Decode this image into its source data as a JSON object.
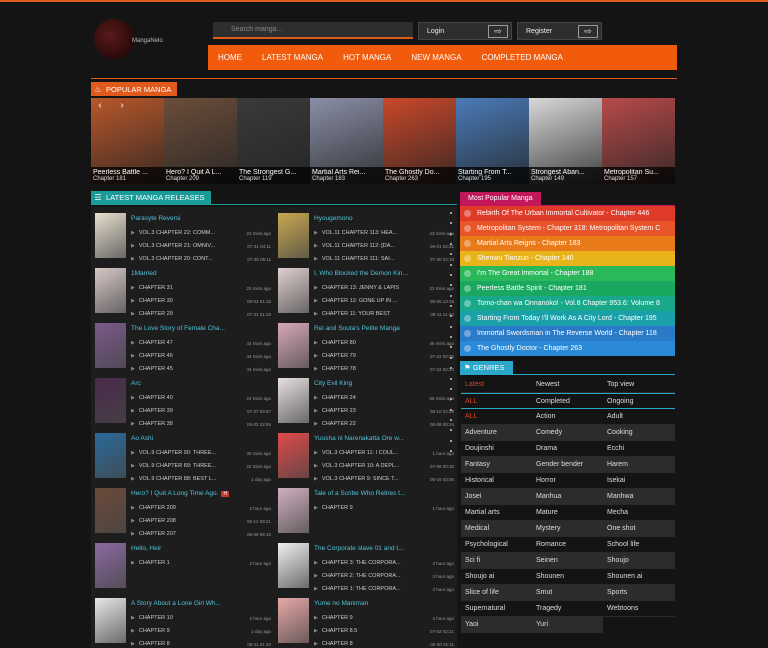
{
  "header": {
    "logo_text": "MangaNelo",
    "search_placeholder": "Search manga...",
    "login_label": "Login",
    "register_label": "Register"
  },
  "nav": [
    "HOME",
    "LATEST MANGA",
    "HOT MANGA",
    "NEW MANGA",
    "COMPLETED MANGA"
  ],
  "popular": {
    "title": "POPULAR MANGA",
    "items": [
      {
        "title": "Peerless Battle ...",
        "chapter": "Chapter 181",
        "color": "#b8572a"
      },
      {
        "title": "Hero? I Quit A L...",
        "chapter": "Chapter 209",
        "color": "#6b4d3a"
      },
      {
        "title": "The Strongest G...",
        "chapter": "Chapter 119",
        "color": "#3a3a3a"
      },
      {
        "title": "Martial Arts Rei...",
        "chapter": "Chapter 183",
        "color": "#8a8fa6"
      },
      {
        "title": "The Ghostly Do...",
        "chapter": "Chapter 263",
        "color": "#c9482a"
      },
      {
        "title": "Starting From T...",
        "chapter": "Chapter 195",
        "color": "#4a7bb8"
      },
      {
        "title": "Strongest Aban...",
        "chapter": "Chapter 149",
        "color": "#d8d8d8"
      },
      {
        "title": "Metropolitan Su...",
        "chapter": "Chapter 157",
        "color": "#b84a4a"
      }
    ]
  },
  "latest": {
    "title": "LATEST MANGA RELEASES",
    "left": [
      {
        "title": "Parasyte Reversi",
        "color": "#e8e0d0",
        "hot": false,
        "chapters": [
          [
            "VOL.3 CHAPTER 22: COMM...",
            "23 mins ago"
          ],
          [
            "VOL.3 CHAPTER 21: OMNIV...",
            "07-31 04:11"
          ],
          [
            "VOL.3 CHAPTER 20: CONT...",
            "07-30 05:11"
          ]
        ]
      },
      {
        "title": "1Married",
        "color": "#d8c8c8",
        "hot": false,
        "chapters": [
          [
            "CHAPTER 31",
            "23 mins ago"
          ],
          [
            "CHAPTER 30",
            "08-03 01:16"
          ],
          [
            "CHAPTER 29",
            "07-31 21:16"
          ]
        ]
      },
      {
        "title": "The Love Story of Female Cha...",
        "color": "#7a5a8a",
        "hot": false,
        "chapters": [
          [
            "CHAPTER 47",
            "44 mins ago"
          ],
          [
            "CHAPTER 46",
            "44 mins ago"
          ],
          [
            "CHAPTER 45",
            "44 mins ago"
          ]
        ]
      },
      {
        "title": "Arc",
        "color": "#4a2a4a",
        "hot": false,
        "chapters": [
          [
            "CHAPTER 40",
            "24 mins ago"
          ],
          [
            "CHAPTER 39",
            "07-27 03:57"
          ],
          [
            "CHAPTER 38",
            "05-02 22:55"
          ]
        ]
      },
      {
        "title": "Ao Ashi",
        "color": "#2a6a9a",
        "hot": false,
        "chapters": [
          [
            "VOL.9 CHAPTER 90: THREE...",
            "30 mins ago"
          ],
          [
            "VOL.9 CHAPTER 89: THREE...",
            "22 mins ago"
          ],
          [
            "VOL.9 CHAPTER 88: BEST L...",
            "1 day ago"
          ]
        ]
      },
      {
        "title": "Hero? I Quit A Long Time Ago.",
        "color": "#6a4a3a",
        "hot": true,
        "chapters": [
          [
            "CHAPTER 209",
            "2 hour ago"
          ],
          [
            "CHAPTER 208",
            "06-12 08:21"
          ],
          [
            "CHAPTER 207",
            "06-09 06:15"
          ]
        ]
      },
      {
        "title": "Hello, Heir",
        "color": "#8a6aa0",
        "hot": false,
        "chapters": [
          [
            "CHAPTER 1",
            "2 hour ago"
          ]
        ]
      },
      {
        "title": "A Story About a Lone Girl Wh...",
        "color": "#e8e8e8",
        "hot": false,
        "chapters": [
          [
            "CHAPTER 10",
            "2 hour ago"
          ],
          [
            "CHAPTER 9",
            "2 day ago"
          ],
          [
            "CHAPTER 8",
            "08-11 21:33"
          ]
        ]
      }
    ],
    "right": [
      {
        "title": "Hyougemono",
        "color": "#c8a850",
        "hot": false,
        "chapters": [
          [
            "VOL.11 CHAPTER 113: HEA...",
            "23 mins ago"
          ],
          [
            "VOL.11 CHAPTER 112: [DA...",
            "08-01 02:31"
          ],
          [
            "VOL.11 CHAPTER 111: SAI...",
            "07-30 22:19"
          ]
        ]
      },
      {
        "title": "I, Who Blocked the Demon Kin...",
        "color": "#e0d0d0",
        "hot": false,
        "chapters": [
          [
            "CHAPTER 13: JENNY & LAPIS",
            "23 mins ago"
          ],
          [
            "CHAPTER 12: GONE UP IN ...",
            "08-05 13:16"
          ],
          [
            "CHAPTER 11: YOUR BEST",
            "08-11 21:42"
          ]
        ]
      },
      {
        "title": "Rei and Souta's Petite Manga",
        "color": "#d8a8b8",
        "hot": false,
        "chapters": [
          [
            "CHAPTER 80",
            "46 mins ago"
          ],
          [
            "CHAPTER 79",
            "07-22 02:25"
          ],
          [
            "CHAPTER 78",
            "07-22 02:24"
          ]
        ]
      },
      {
        "title": "City Evil King",
        "color": "#e8e0e0",
        "hot": false,
        "chapters": [
          [
            "CHAPTER 24",
            "55 mins ago"
          ],
          [
            "CHAPTER 23",
            "08-10 22:28"
          ],
          [
            "CHAPTER 22",
            "08-08 00:24"
          ]
        ]
      },
      {
        "title": "Yuusha ni Narenakatta Ore w...",
        "color": "#e04a4a",
        "hot": false,
        "chapters": [
          [
            "VOL.3 CHAPTER 11: I COUL...",
            "1 hour ago"
          ],
          [
            "VOL.3 CHAPTER 10: A DEPL...",
            "07-08 00:15"
          ],
          [
            "VOL.3 CHAPTER 9: SINCE T...",
            "05-16 03:05"
          ]
        ]
      },
      {
        "title": "Tale of a Scribe Who Retires t...",
        "color": "#d0b0c0",
        "hot": false,
        "chapters": [
          [
            "CHAPTER 9",
            "1 hour ago"
          ]
        ]
      },
      {
        "title": "The Corporate slave 01 and t...",
        "color": "#f0f0f0",
        "hot": false,
        "chapters": [
          [
            "CHAPTER 3: THE CORPORA...",
            "2 hour ago"
          ],
          [
            "CHAPTER 2: THE CORPORA...",
            "2 hour ago"
          ],
          [
            "CHAPTER 1: THE CORPORA...",
            "2 hour ago"
          ]
        ]
      },
      {
        "title": "Yume no Maniman",
        "color": "#e8a8a8",
        "hot": false,
        "chapters": [
          [
            "CHAPTER 9",
            "2 hour ago"
          ],
          [
            "CHAPTER 8.5",
            "07-02 02:21"
          ],
          [
            "CHAPTER 8",
            "06-30 01:11"
          ]
        ]
      }
    ]
  },
  "most_popular": {
    "title": "Most Popular Manga",
    "items": [
      {
        "label": "Rebirth Of The Urban Immortal Cultivator - Chapter 446",
        "color": "#e03a2a"
      },
      {
        "label": "Metropolitan System - Chapter 318: Metropolitan System C",
        "color": "#e8552a"
      },
      {
        "label": "Martial Arts Reigns - Chapter 183",
        "color": "#e87a1a"
      },
      {
        "label": "Shenwu Tianzun - Chapter 140",
        "color": "#e8b41a"
      },
      {
        "label": "I'm The Great Immortal - Chapter 188",
        "color": "#2ab85a"
      },
      {
        "label": "Peerless Battle Spirit - Chapter 181",
        "color": "#1aa860"
      },
      {
        "label": "Tomo-chan wa Onnanoko! - Vol.8 Chapter 953.6: Volume 8",
        "color": "#1aa88a"
      },
      {
        "label": "Starting From Today I'll Work As A City Lord - Chapter 195",
        "color": "#1aa0a8"
      },
      {
        "label": "Immortal Swordsman in The Reverse World - Chapter 118",
        "color": "#2a7ac8"
      },
      {
        "label": "The Ghostly Doctor - Chapter 263",
        "color": "#2a8ad8"
      }
    ]
  },
  "genres": {
    "title": "GENRES",
    "tabs": [
      "Latest",
      "Newest",
      "Top view"
    ],
    "status": [
      "ALL",
      "Completed",
      "Ongoing"
    ],
    "items": [
      "ALL",
      "Action",
      "Adult",
      "Adventure",
      "Comedy",
      "Cooking",
      "Doujinshi",
      "Drama",
      "Ecchi",
      "Fantasy",
      "Gender bender",
      "Harem",
      "Historical",
      "Horror",
      "Isekai",
      "Josei",
      "Manhua",
      "Manhwa",
      "Martial arts",
      "Mature",
      "Mecha",
      "Medical",
      "Mystery",
      "One shot",
      "Psychological",
      "Romance",
      "School life",
      "Sci fi",
      "Seinen",
      "Shoujo",
      "Shoujo ai",
      "Shounen",
      "Shounen ai",
      "Slice of life",
      "Smut",
      "Sports",
      "Supernatural",
      "Tragedy",
      "Webtoons",
      "Yaoi",
      "Yuri"
    ]
  }
}
